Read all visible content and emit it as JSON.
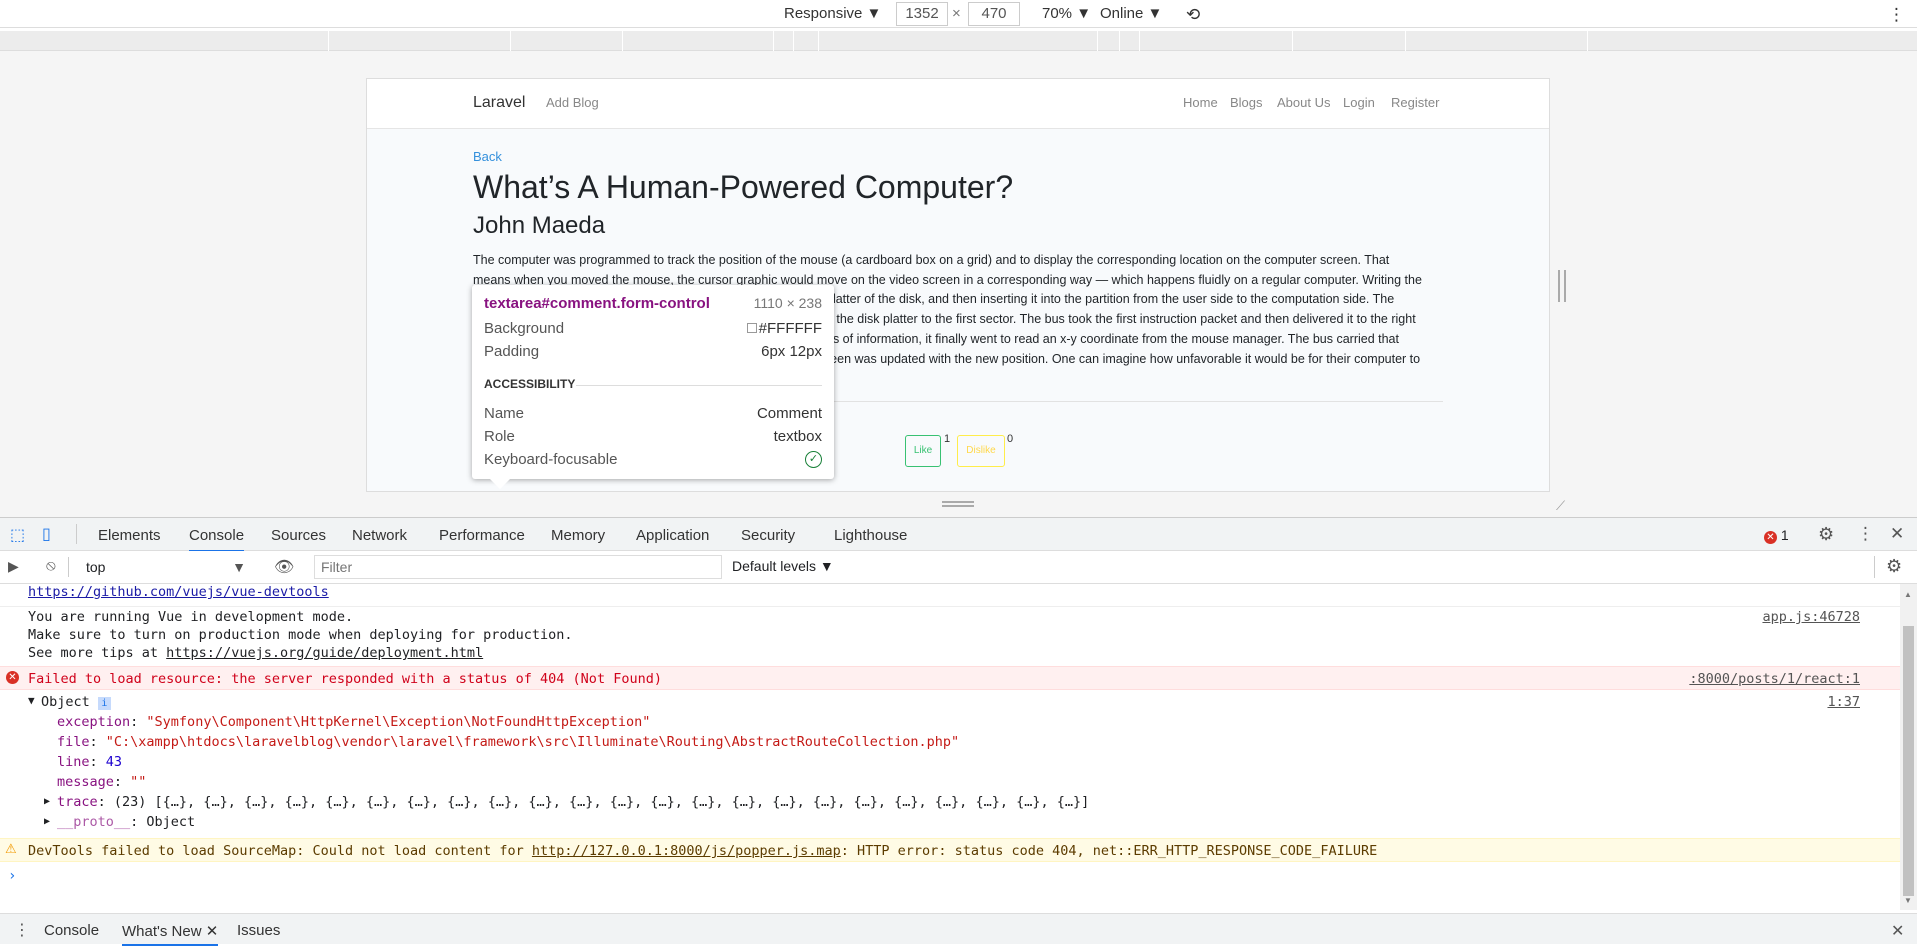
{
  "device_toolbar": {
    "device": "Responsive",
    "width": "1352",
    "times": "×",
    "height": "470",
    "zoom": "70%",
    "network": "Online"
  },
  "site": {
    "brand": "Laravel",
    "add_blog": "Add Blog",
    "nav": [
      "Home",
      "Blogs",
      "About Us",
      "Login",
      "Register"
    ],
    "back": "Back",
    "title": "What’s A Human-Powered Computer?",
    "author": "John Maeda",
    "body_lines": [
      "The computer was programmed to track the position of the mouse (a cardboard box on a grid) and to display the corresponding location on the computer screen. That",
      "means when you moved the mouse, the cursor graphic would move on the video screen in a corresponding way — which happens fluidly on a regular computer. Writing the",
      "platter of the disk, and then inserting it into the partition from the user side to the computation side. The",
      "n the disk platter to the first sector. The bus took the first instruction packet and then delivered it to the right",
      "ds of information, it finally went to read an x-y coordinate from the mouse manager. The bus carried that",
      "reen was updated with the new position. One can imagine how unfavorable it would be for their computer to"
    ],
    "like_label": "Like",
    "like_count": "1",
    "dislike_label": "Dislike",
    "dislike_count": "0"
  },
  "tooltip": {
    "selector": "textarea#comment.form-control",
    "size": "1110 × 238",
    "background_label": "Background",
    "background_value": "#FFFFFF",
    "padding_label": "Padding",
    "padding_value": "6px 12px",
    "section": "ACCESSIBILITY",
    "name_label": "Name",
    "name_value": "Comment",
    "role_label": "Role",
    "role_value": "textbox",
    "focus_label": "Keyboard-focusable"
  },
  "devtools": {
    "tabs": [
      "Elements",
      "Console",
      "Sources",
      "Network",
      "Performance",
      "Memory",
      "Application",
      "Security",
      "Lighthouse"
    ],
    "active_tab": "Console",
    "error_count": "1",
    "context": "top",
    "filter_placeholder": "Filter",
    "levels": "Default levels"
  },
  "console": {
    "line_devtools_link": "https://github.com/vuejs/vue-devtools",
    "vue_msg_1": "You are running Vue in development mode.",
    "vue_msg_2": "Make sure to turn on production mode when deploying for production.",
    "vue_msg_3_prefix": "See more tips at ",
    "vue_msg_3_link": "https://vuejs.org/guide/deployment.html",
    "vue_src": "app.js:46728",
    "error_msg": "Failed to load resource: the server responded with a status of 404 (Not Found)",
    "error_src": ":8000/posts/1/react:1",
    "object_label": "Object",
    "object_src": "1:37",
    "exception_key": "exception",
    "exception_val": "\"Symfony\\Component\\HttpKernel\\Exception\\NotFoundHttpException\"",
    "file_key": "file",
    "file_val": "\"C:\\xampp\\htdocs\\laravelblog\\vendor\\laravel\\framework\\src\\Illuminate\\Routing\\AbstractRouteCollection.php\"",
    "line_key": "line",
    "line_val": "43",
    "message_key": "message",
    "message_val": "\"\"",
    "trace_key": "trace",
    "trace_val": "(23) [{…}, {…}, {…}, {…}, {…}, {…}, {…}, {…}, {…}, {…}, {…}, {…}, {…}, {…}, {…}, {…}, {…}, {…}, {…}, {…}, {…}, {…}, {…}]",
    "proto_key": "__proto__",
    "proto_val": "Object",
    "warn_prefix": "DevTools failed to load SourceMap: Could not load content for ",
    "warn_link": "http://127.0.0.1:8000/js/popper.js.map",
    "warn_suffix": ": HTTP error: status code 404, net::ERR_HTTP_RESPONSE_CODE_FAILURE"
  },
  "drawer": {
    "tabs": [
      "Console",
      "What's New",
      "Issues"
    ]
  },
  "colors": {
    "accent": "#1a73e8",
    "error": "#d0021b",
    "success": "#38c172",
    "warning": "#ffed4a"
  }
}
